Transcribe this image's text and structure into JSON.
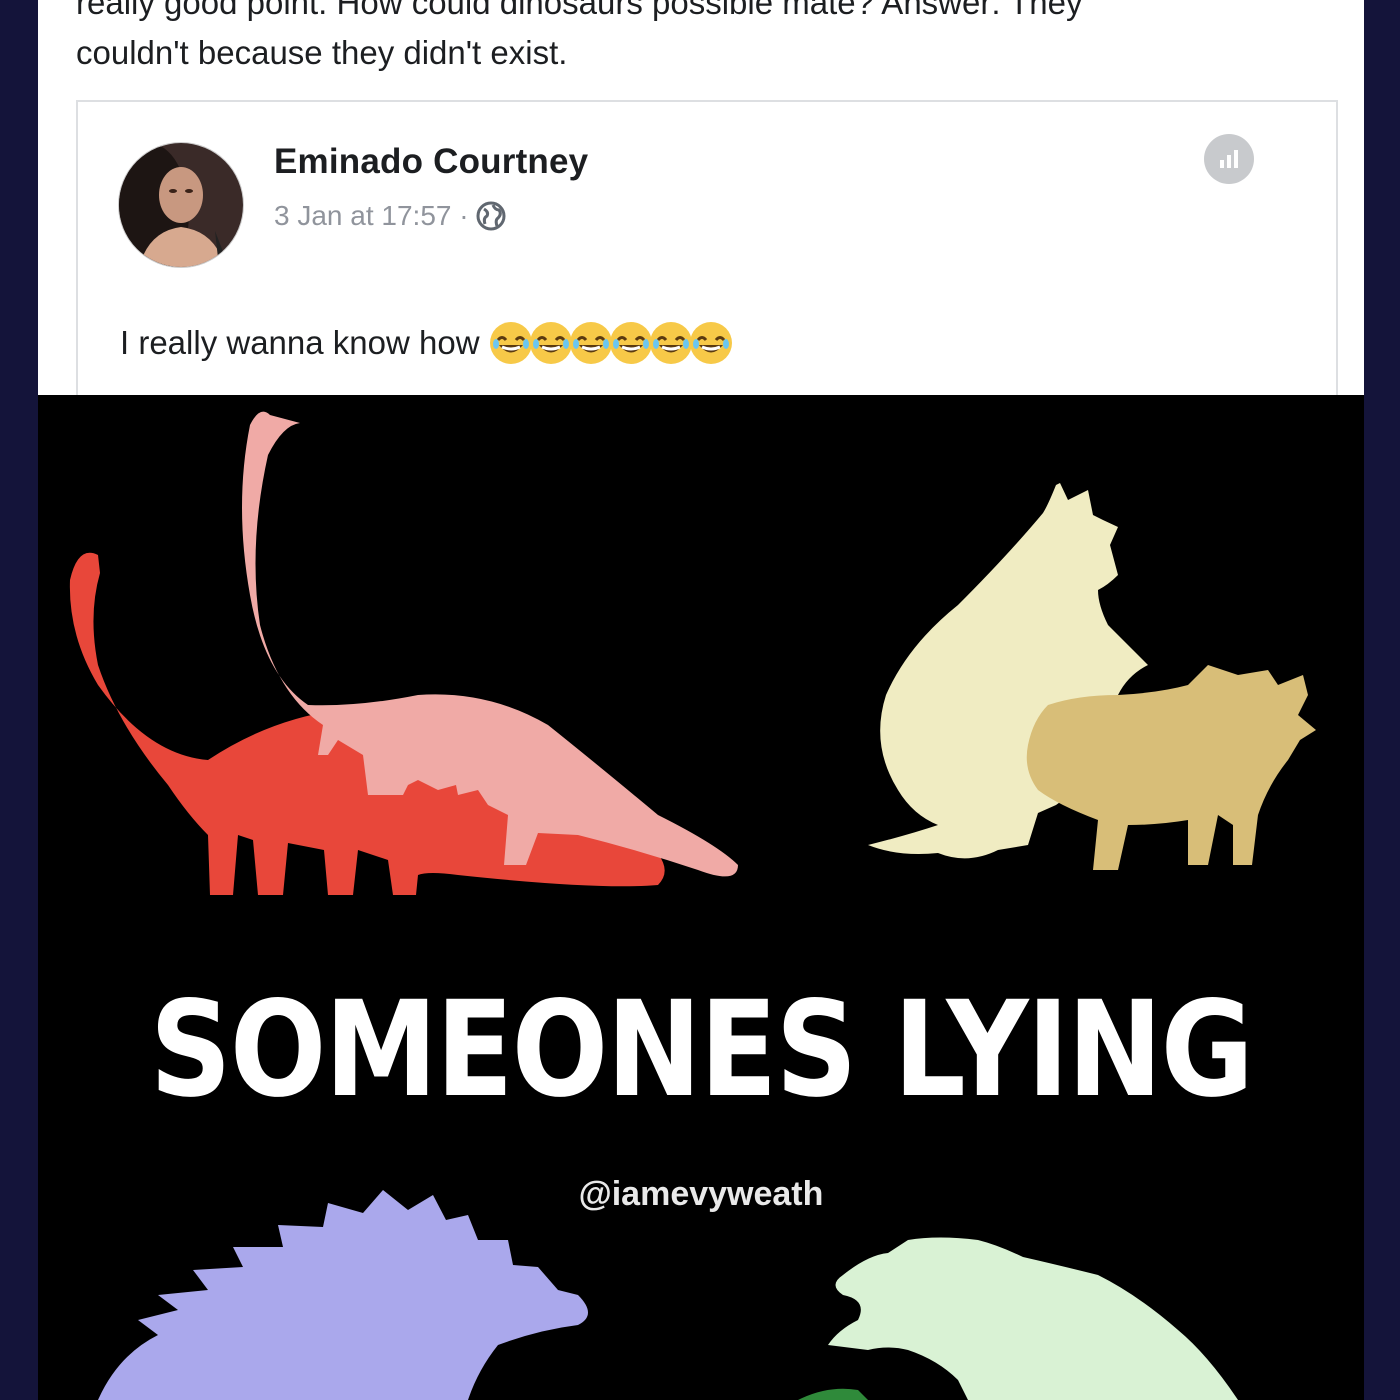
{
  "post": {
    "text_line_1": "really good point. How could dinosaurs possible mate? Answer: They",
    "text_line_2": "couldn't because they didn't exist."
  },
  "shared_post": {
    "author": "Eminado Courtney",
    "timestamp": "3 Jan at 17:57 ·",
    "privacy_icon": "globe-icon",
    "more_icon": "more-options-icon",
    "comment": "I really wanna know how",
    "emoji_icon": "laughing-emoji-icon",
    "emoji_count": 6
  },
  "meme": {
    "caption": "SOMEONES LYING",
    "handle": "@iamevyweath",
    "colors": {
      "sauropod_bottom": "#e8473a",
      "sauropod_top": "#f0aaa6",
      "triceratops_top": "#f0ecc2",
      "triceratops_bottom": "#d8be78",
      "stegosaur": "#aaa8ec",
      "trex": "#d9f2d4"
    }
  },
  "colors": {
    "page_background": "#14143a",
    "card_background": "#ffffff",
    "meme_background": "#000000"
  }
}
